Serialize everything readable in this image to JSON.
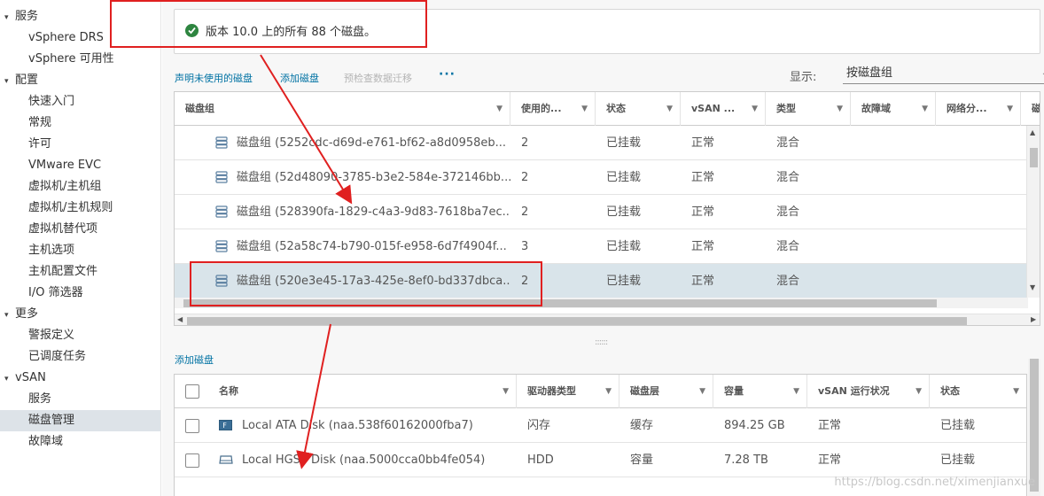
{
  "sidebar": {
    "items": [
      {
        "label": "服务",
        "kind": "group"
      },
      {
        "label": "vSphere DRS",
        "kind": "item"
      },
      {
        "label": "vSphere 可用性",
        "kind": "item"
      },
      {
        "label": "配置",
        "kind": "group"
      },
      {
        "label": "快速入门",
        "kind": "item"
      },
      {
        "label": "常规",
        "kind": "item"
      },
      {
        "label": "许可",
        "kind": "item"
      },
      {
        "label": "VMware EVC",
        "kind": "item"
      },
      {
        "label": "虚拟机/主机组",
        "kind": "item"
      },
      {
        "label": "虚拟机/主机规则",
        "kind": "item"
      },
      {
        "label": "虚拟机替代项",
        "kind": "item"
      },
      {
        "label": "主机选项",
        "kind": "item"
      },
      {
        "label": "主机配置文件",
        "kind": "item"
      },
      {
        "label": "I/O 筛选器",
        "kind": "item"
      },
      {
        "label": "更多",
        "kind": "group"
      },
      {
        "label": "警报定义",
        "kind": "item"
      },
      {
        "label": "已调度任务",
        "kind": "item"
      },
      {
        "label": "vSAN",
        "kind": "group"
      },
      {
        "label": "服务",
        "kind": "item"
      },
      {
        "label": "磁盘管理",
        "kind": "item",
        "active": true
      },
      {
        "label": "故障域",
        "kind": "item"
      }
    ]
  },
  "banner": {
    "text": "版本 10.0 上的所有 88 个磁盘。",
    "status_icon": "check-circle-icon",
    "status_color": "#2e8540"
  },
  "toolbar": {
    "claim_unused": "声明未使用的磁盘",
    "add_disk": "添加磁盘",
    "precheck_migration": "预检查数据迁移",
    "more": "···",
    "show_label": "显示:",
    "show_value": "按磁盘组"
  },
  "disk_groups": {
    "columns": [
      "磁盘组",
      "使用的...",
      "状态",
      "vSAN ...",
      "类型",
      "故障域",
      "网络分...",
      "磁"
    ],
    "rows": [
      {
        "name": "磁盘组 (5252cdc-d69d-e761-bf62-a8d0958eb...",
        "used": "2",
        "state": "已挂载",
        "vsan": "正常",
        "type": "混合",
        "selected": false
      },
      {
        "name": "磁盘组 (52d48090-3785-b3e2-584e-372146bb...",
        "used": "2",
        "state": "已挂载",
        "vsan": "正常",
        "type": "混合",
        "selected": false
      },
      {
        "name": "磁盘组 (528390fa-1829-c4a3-9d83-7618ba7ec...",
        "used": "2",
        "state": "已挂载",
        "vsan": "正常",
        "type": "混合",
        "selected": false
      },
      {
        "name": "磁盘组 (52a58c74-b790-015f-e958-6d7f4904f...",
        "used": "3",
        "state": "已挂载",
        "vsan": "正常",
        "type": "混合",
        "selected": false
      },
      {
        "name": "磁盘组 (520e3e45-17a3-425e-8ef0-bd337dbca...",
        "used": "2",
        "state": "已挂载",
        "vsan": "正常",
        "type": "混合",
        "selected": true
      }
    ]
  },
  "lower": {
    "add_disk": "添加磁盘",
    "columns": [
      "名称",
      "驱动器类型",
      "磁盘层",
      "容量",
      "vSAN 运行状况",
      "状态"
    ],
    "rows": [
      {
        "name": "Local ATA Disk (naa.538f60162000fba7)",
        "icon": "flash-disk-icon",
        "drive_type": "闪存",
        "tier": "缓存",
        "capacity": "894.25 GB",
        "health": "正常",
        "state": "已挂载"
      },
      {
        "name": "Local HGST Disk (naa.5000cca0bb4fe054)",
        "icon": "hdd-disk-icon",
        "drive_type": "HDD",
        "tier": "容量",
        "capacity": "7.28 TB",
        "health": "正常",
        "state": "已挂载"
      }
    ]
  },
  "annotation_color": "#e02020",
  "watermark": "https://blog.csdn.net/ximenjianxue"
}
